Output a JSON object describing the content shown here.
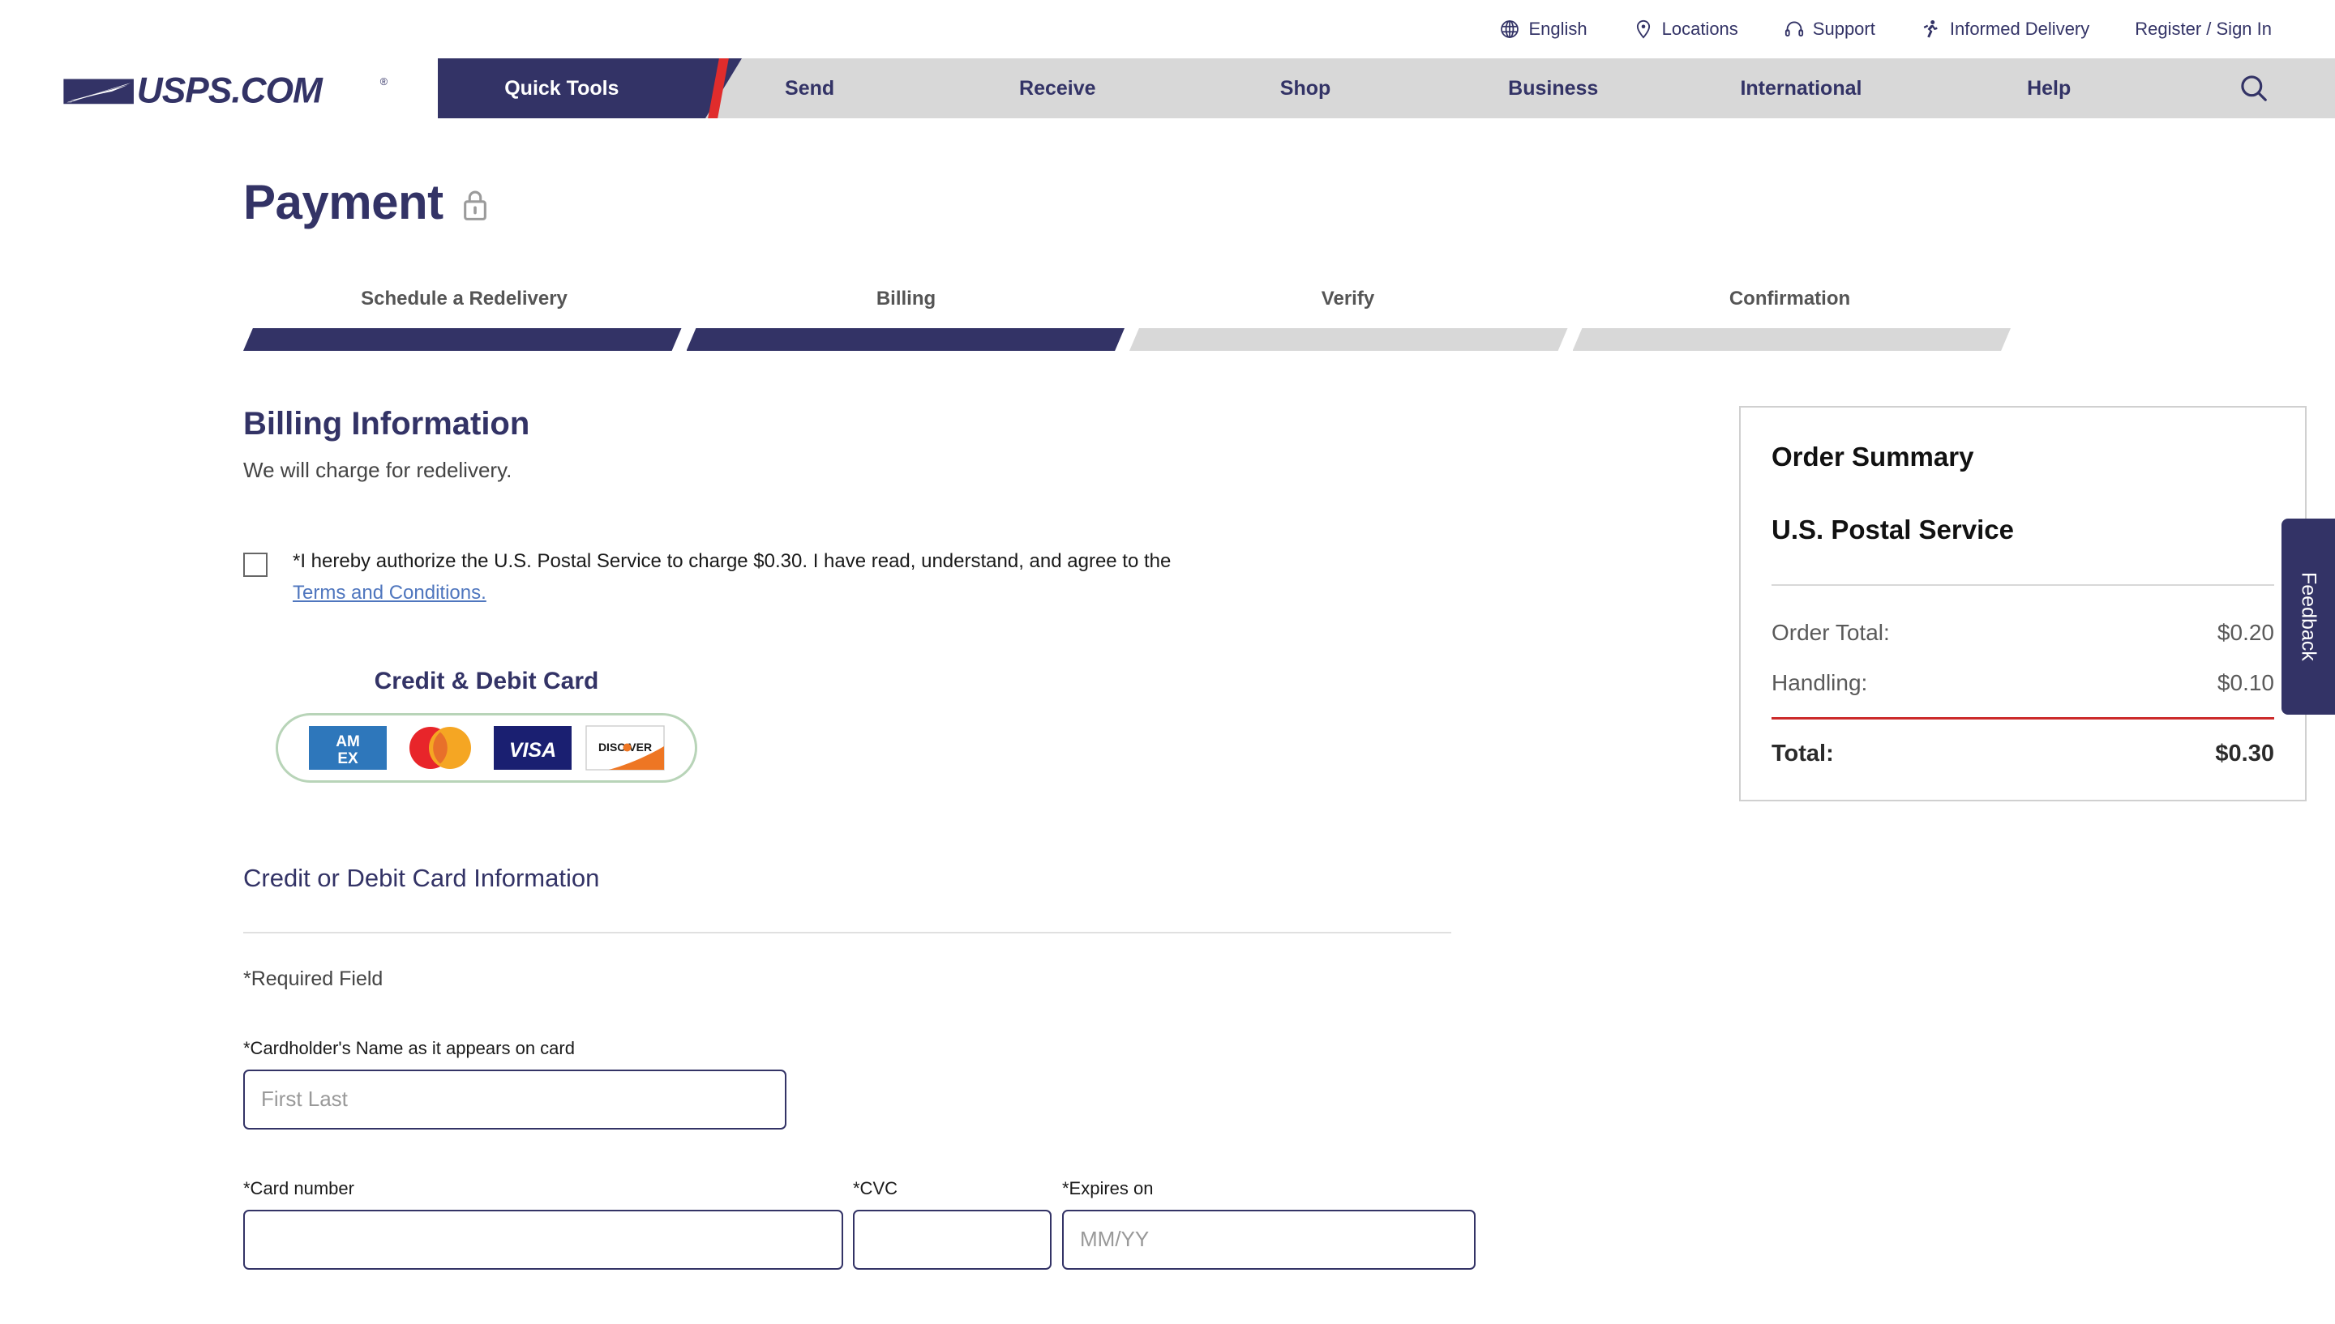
{
  "utility_nav": [
    {
      "label": "English",
      "icon": "globe-icon"
    },
    {
      "label": "Locations",
      "icon": "map-pin-icon"
    },
    {
      "label": "Support",
      "icon": "headset-icon"
    },
    {
      "label": "Informed Delivery",
      "icon": "informed-delivery-icon"
    },
    {
      "label": "Register / Sign In",
      "icon": "none"
    }
  ],
  "main_nav": {
    "logo_text": "USPS.COM",
    "items": [
      {
        "label": "Quick Tools",
        "active": true
      },
      {
        "label": "Send",
        "active": false
      },
      {
        "label": "Receive",
        "active": false
      },
      {
        "label": "Shop",
        "active": false
      },
      {
        "label": "Business",
        "active": false
      },
      {
        "label": "International",
        "active": false
      },
      {
        "label": "Help",
        "active": false
      }
    ],
    "search_icon": "search-icon"
  },
  "header": {
    "title": "Payment",
    "lock_icon": "lock-icon"
  },
  "stepper": {
    "steps": [
      {
        "label": "Schedule a Redelivery",
        "state": "done"
      },
      {
        "label": "Billing",
        "state": "done"
      },
      {
        "label": "Verify",
        "state": "pending"
      },
      {
        "label": "Confirmation",
        "state": "pending"
      }
    ]
  },
  "billing": {
    "heading": "Billing Information",
    "subheading": "We will charge for redelivery.",
    "authorization": {
      "checked": false,
      "text": "*I hereby authorize the U.S. Postal Service to charge $0.30. I have read, understand, and agree to the",
      "link_text": "Terms and Conditions."
    },
    "card_brand_title": "Credit & Debit Card",
    "card_brands": [
      "AMEX",
      "Mastercard",
      "VISA",
      "DISCOVER"
    ],
    "card_info_heading": "Credit or Debit Card Information",
    "required_note": "*Required Field",
    "fields": {
      "cardholder": {
        "label": "*Cardholder's Name as it appears on card",
        "placeholder": "First Last",
        "value": ""
      },
      "card_number": {
        "label": "*Card number",
        "placeholder": "",
        "value": ""
      },
      "cvc": {
        "label": "*CVC",
        "placeholder": "",
        "value": ""
      },
      "expires": {
        "label": "*Expires on",
        "placeholder": "MM/YY",
        "value": ""
      }
    }
  },
  "order_summary": {
    "title": "Order Summary",
    "merchant": "U.S. Postal Service",
    "lines": [
      {
        "label": "Order Total:",
        "amount": "$0.20"
      },
      {
        "label": "Handling:",
        "amount": "$0.10"
      }
    ],
    "total_label": "Total:",
    "total_amount": "$0.30"
  },
  "feedback": {
    "label": "Feedback"
  },
  "colors": {
    "usps_navy": "#333366",
    "usps_red": "#e02c2c",
    "nav_gray": "#d8d8d8",
    "link_blue": "#4f76be",
    "total_rule_red": "#cc2b2b"
  }
}
